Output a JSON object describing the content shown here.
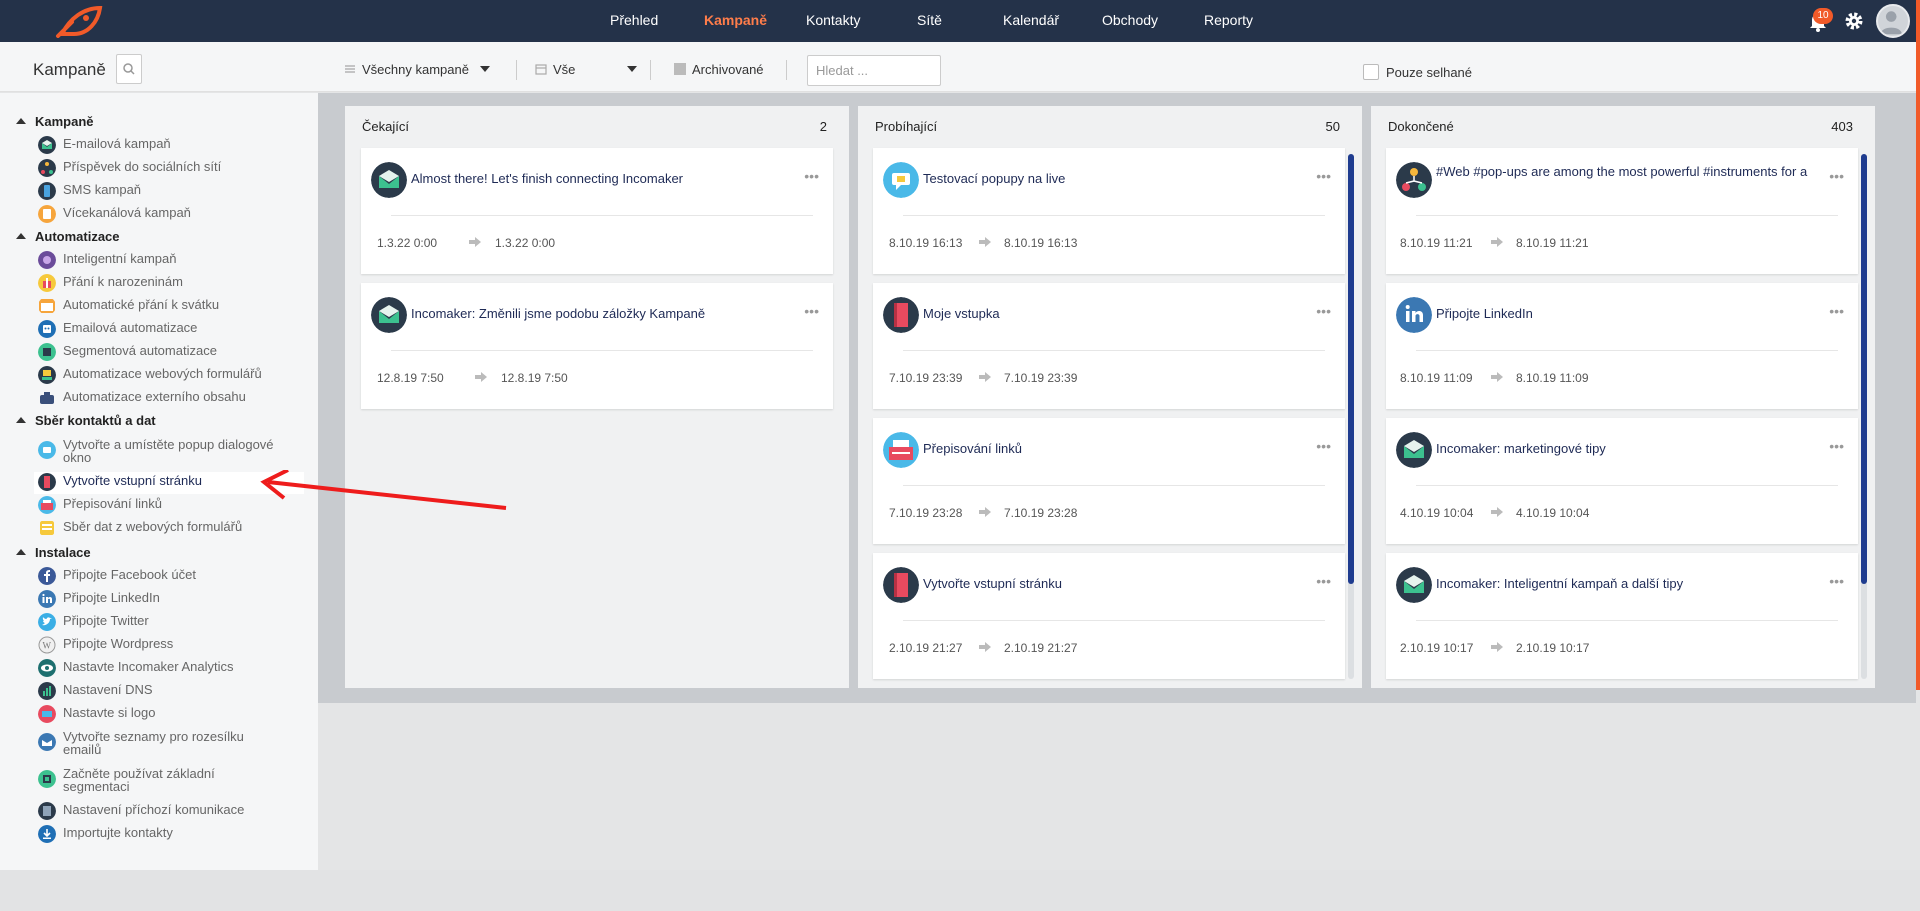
{
  "nav": {
    "items": [
      {
        "label": "Přehled",
        "active": false
      },
      {
        "label": "Kampaně",
        "active": true
      },
      {
        "label": "Kontakty",
        "active": false
      },
      {
        "label": "Sítě",
        "active": false
      },
      {
        "label": "Kalendář",
        "active": false
      },
      {
        "label": "Obchody",
        "active": false
      },
      {
        "label": "Reporty",
        "active": false
      }
    ],
    "notifications_count": "10",
    "icons": [
      "rocket-logo",
      "bell-icon",
      "gear-icon",
      "avatar"
    ],
    "accent_color": "#ff7d4a",
    "bar_color": "#243249"
  },
  "toolbar": {
    "title": "Kampaně",
    "campaign_filter": "Všechny kampaně",
    "date_filter": "Vše",
    "archived_label": "Archivované",
    "search_placeholder": "Hledat ...",
    "failed_only_label": "Pouze selhané"
  },
  "sidebar": {
    "sections": [
      {
        "title": "Kampaně",
        "items": [
          {
            "label": "E-mailová kampaň",
            "icon": "envelope-icon"
          },
          {
            "label": "Příspěvek do sociálních sítí",
            "icon": "social-icon"
          },
          {
            "label": "SMS kampaň",
            "icon": "sms-icon"
          },
          {
            "label": "Vícekanálová kampaň",
            "icon": "multichannel-icon"
          }
        ]
      },
      {
        "title": "Automatizace",
        "items": [
          {
            "label": "Inteligentní kampaň",
            "icon": "brain-icon"
          },
          {
            "label": "Přání k narozeninám",
            "icon": "gift-icon"
          },
          {
            "label": "Automatické přání k svátku",
            "icon": "calendar-icon"
          },
          {
            "label": "Emailová automatizace",
            "icon": "robot-icon"
          },
          {
            "label": "Segmentová automatizace",
            "icon": "segment-icon"
          },
          {
            "label": "Automatizace webových formulářů",
            "icon": "form-robot-icon"
          },
          {
            "label": "Automatizace externího obsahu",
            "icon": "external-icon"
          }
        ]
      },
      {
        "title": "Sběr kontaktů a dat",
        "items": [
          {
            "label": "Vytvořte a umístěte popup dialogové okno",
            "icon": "popup-icon"
          },
          {
            "label": "Vytvořte vstupní stránku",
            "icon": "book-icon",
            "active": true
          },
          {
            "label": "Přepisování linků",
            "icon": "typewriter-icon"
          },
          {
            "label": "Sběr dat z webových formulářů",
            "icon": "form-icon"
          }
        ]
      },
      {
        "title": "Instalace",
        "items": [
          {
            "label": "Připojte Facebook účet",
            "icon": "facebook-icon"
          },
          {
            "label": "Připojte LinkedIn",
            "icon": "linkedin-icon"
          },
          {
            "label": "Připojte Twitter",
            "icon": "twitter-icon"
          },
          {
            "label": "Připojte Wordpress",
            "icon": "wordpress-icon"
          },
          {
            "label": "Nastavte Incomaker Analytics",
            "icon": "eye-icon"
          },
          {
            "label": "Nastavení DNS",
            "icon": "dns-icon"
          },
          {
            "label": "Nastavte si logo",
            "icon": "logo-icon"
          },
          {
            "label": "Vytvořte seznamy pro rozesílku emailů",
            "icon": "mailing-list-icon"
          },
          {
            "label": "Začněte používat základní segmentaci",
            "icon": "segmentation-icon"
          },
          {
            "label": "Nastavení příchozí komunikace",
            "icon": "inbox-icon"
          },
          {
            "label": "Importujte kontakty",
            "icon": "import-icon"
          }
        ]
      }
    ]
  },
  "columns": [
    {
      "title": "Čekající",
      "count": "2",
      "cards": [
        {
          "title": "Almost there! Let's finish connecting Incomaker",
          "icon": "envelope-icon",
          "start": "1.3.22 0:00",
          "end": "1.3.22 0:00"
        },
        {
          "title": "Incomaker: Změnili jsme podobu záložky Kampaně",
          "icon": "envelope-icon",
          "start": "12.8.19 7:50",
          "end": "12.8.19 7:50"
        }
      ]
    },
    {
      "title": "Probíhající",
      "count": "50",
      "cards": [
        {
          "title": "Testovací popupy na live",
          "icon": "popup-icon",
          "start": "8.10.19 16:13",
          "end": "8.10.19 16:13"
        },
        {
          "title": "Moje vstupka",
          "icon": "book-icon",
          "start": "7.10.19 23:39",
          "end": "7.10.19 23:39"
        },
        {
          "title": "Přepisování linků",
          "icon": "typewriter-icon",
          "start": "7.10.19 23:28",
          "end": "7.10.19 23:28"
        },
        {
          "title": "Vytvořte vstupní stránku",
          "icon": "book-icon",
          "start": "2.10.19 21:27",
          "end": "2.10.19 21:27"
        }
      ]
    },
    {
      "title": "Dokončené",
      "count": "403",
      "cards": [
        {
          "title": "#Web #pop-ups are among the most powerful #instruments for a",
          "icon": "social-icon",
          "start": "8.10.19 11:21",
          "end": "8.10.19 11:21"
        },
        {
          "title": "Připojte LinkedIn",
          "icon": "linkedin-icon",
          "start": "8.10.19 11:09",
          "end": "8.10.19 11:09"
        },
        {
          "title": "Incomaker: marketingové tipy",
          "icon": "envelope-icon",
          "start": "4.10.19 10:04",
          "end": "4.10.19 10:04"
        },
        {
          "title": "Incomaker: Inteligentní kampaň a další tipy",
          "icon": "envelope-icon",
          "start": "2.10.19 10:17",
          "end": "2.10.19 10:17"
        }
      ]
    }
  ],
  "card_menu_glyph": "•••"
}
